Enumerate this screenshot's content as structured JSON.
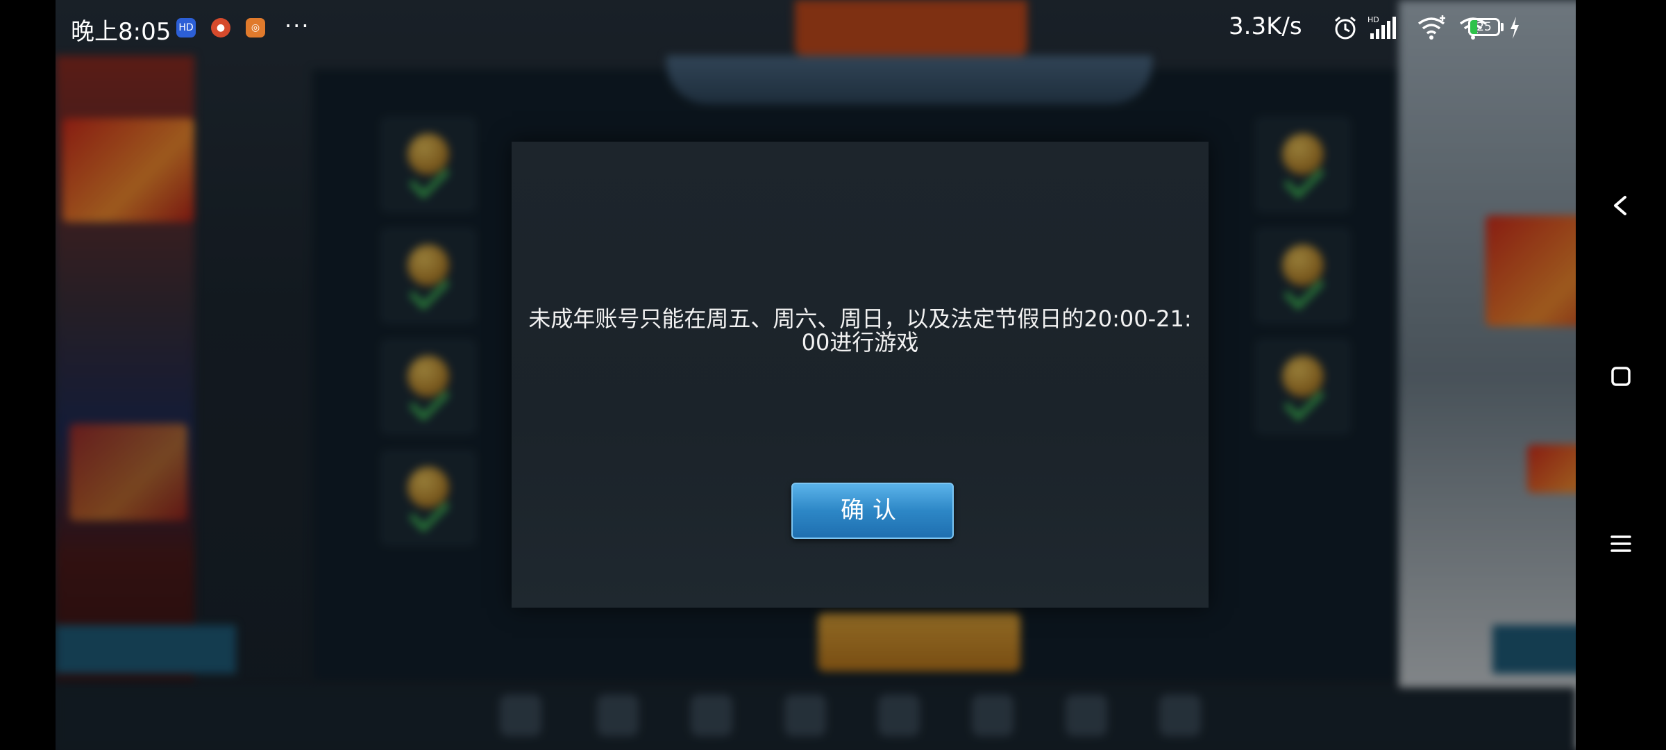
{
  "status_bar": {
    "time": "晚上8:05",
    "network_speed": "3.3K/s",
    "battery_level": "25",
    "more_label": "···",
    "icons": [
      "hd-app-icon",
      "app-icon-2",
      "app-icon-3",
      "alarm-icon",
      "hd-signal-icon",
      "wifi-plus-icon",
      "wifi-icon",
      "battery-icon",
      "charging-icon"
    ]
  },
  "dialog": {
    "message": "未成年账号只能在周五、周六、周日，以及法定节假日的20:00-21:00进行游戏",
    "confirm_label": "确认"
  },
  "system_nav": {
    "icons": [
      "back-icon",
      "home-icon",
      "menu-icon"
    ]
  },
  "colors": {
    "dialog_bg": "#1b232a",
    "confirm_button": "#2d87c6",
    "text": "#f2f2f2"
  }
}
